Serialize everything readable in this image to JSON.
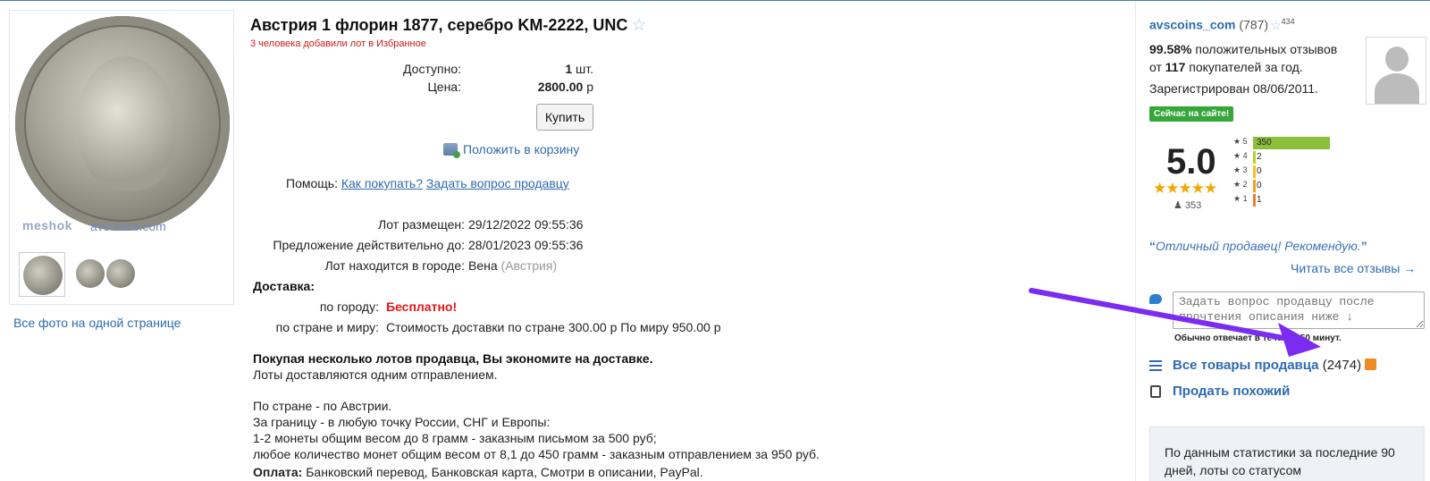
{
  "gallery": {
    "watermark_site": "meshok",
    "watermark_seller": "avscoins.com",
    "all_photos_link": "Все фото на одной странице"
  },
  "lot": {
    "title": "Австрия 1 флорин 1877, серебро KM-2222, UNC",
    "favorites_note": "3 человека добавили лот в Избранное",
    "available_label": "Доступно:",
    "available_value": "1",
    "available_unit": "шт.",
    "price_label": "Цена:",
    "price_value": "2800.00",
    "price_unit": "р",
    "buy_button": "Купить",
    "cart_link": "Положить в корзину",
    "help_label": "Помощь:",
    "help_link_1": "Как покупать?",
    "help_link_2": "Задать вопрос продавцу",
    "posted_label": "Лот размещен:",
    "posted_value": "29/12/2022 09:55:36",
    "valid_label": "Предложение действительно до:",
    "valid_value": "28/01/2023 09:55:36",
    "city_label": "Лот находится в городе:",
    "city_value": "Вена",
    "city_country": "(Австрия)",
    "delivery_head": "Доставка:",
    "city_delivery_label": "по городу:",
    "city_delivery_value": "Бесплатно!",
    "country_delivery_label": "по стране и миру:",
    "country_delivery_value": "Стоимость доставки по стране 300.00 р По миру 950.00 р",
    "multi_lot_head": "Покупая несколько лотов продавца, Вы экономите на доставке.",
    "multi_lot_text": "Лоты доставляются одним отправлением.",
    "desc_lines": [
      "По стране - по Австрии.",
      "За границу - в любую точку России, СНГ и Европы:",
      "1-2 монеты общим весом до 8 грамм - заказным письмом за 500 руб;",
      "любое количество монет общим весом от 8,1 до 450 грамм - заказным отправлением за 950 руб."
    ],
    "payment_label": "Оплата:",
    "payment_value": "Банковский перевод, Банковская карта, Смотри в описании, PayPal."
  },
  "seller": {
    "name": "avscoins_com",
    "count": "(787)",
    "stars_sup": "434",
    "positive_pct": "99.58%",
    "positive_text": "положительных отзывов",
    "from_label": "от",
    "buyers_count": "117",
    "buyers_text": "покупателей за год.",
    "registered": "Зарегистрирован 08/06/2011.",
    "online_badge": "Сейчас на сайте!",
    "rating": "5.0",
    "stars_glyph": "★★★★★",
    "reviewers": "353",
    "rating_bars": [
      {
        "label": "★ 5",
        "count": "350",
        "value": 350,
        "color": "#8cbf3a"
      },
      {
        "label": "★ 4",
        "count": "2",
        "value": 2,
        "color": "#b6d21f"
      },
      {
        "label": "★ 3",
        "count": "0",
        "value": 0,
        "color": "#f2c31b"
      },
      {
        "label": "★ 2",
        "count": "0",
        "value": 0,
        "color": "#f3a21d"
      },
      {
        "label": "★ 1",
        "count": "1",
        "value": 1,
        "color": "#ee7d33"
      }
    ],
    "quote": "Отличный продавец! Рекомендую.",
    "read_all": "Читать все отзывы →",
    "ask_placeholder": "Задать вопрос продавцу после прочтения описания ниже ↓",
    "reply_time": "Обычно отвечает в течение 50 минут.",
    "all_items_link": "Все товары продавца",
    "all_items_count": "(2474)",
    "sell_similar": "Продать похожий",
    "stats_text": "По данным статистики за последние 90 дней, лоты со статусом"
  }
}
